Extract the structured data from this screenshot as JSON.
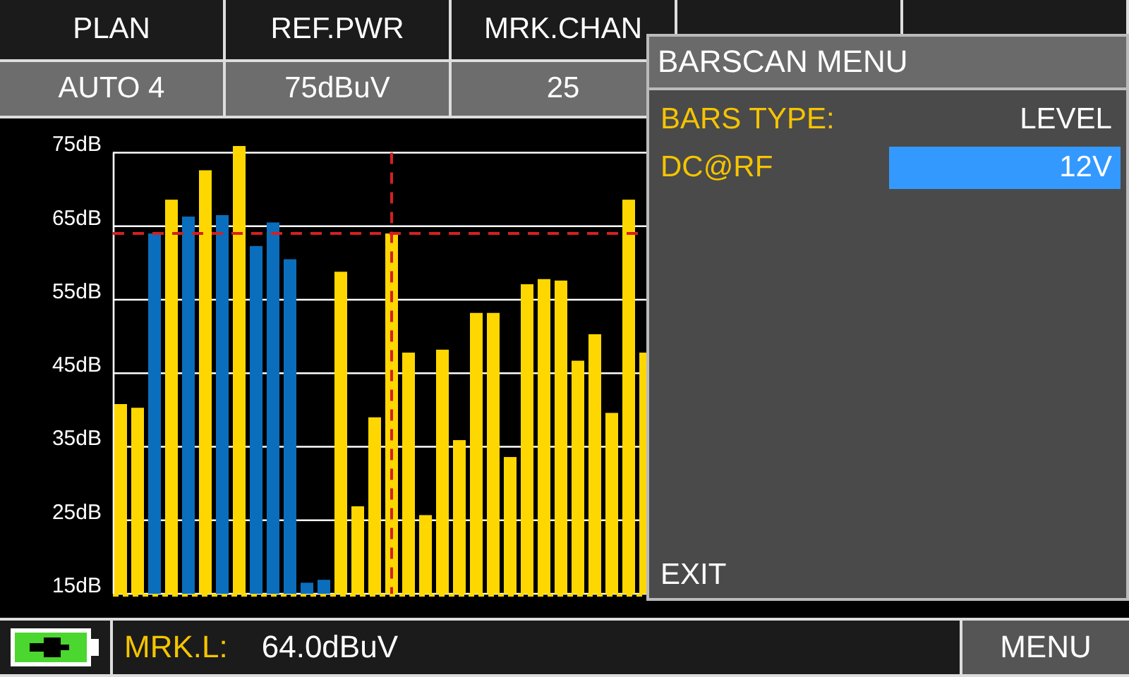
{
  "header": {
    "columns": [
      {
        "title": "PLAN",
        "value": "AUTO 4"
      },
      {
        "title": "REF.PWR",
        "value": "75dBuV"
      },
      {
        "title": "MRK.CHAN",
        "value": "25"
      },
      {},
      {}
    ]
  },
  "chart": {
    "chart_data": {
      "type": "bar",
      "ylim": [
        15,
        76
      ],
      "grid": true,
      "stacked": true,
      "yticks": [
        {
          "value": 75,
          "label": "75dB"
        },
        {
          "value": 65,
          "label": "65dB"
        },
        {
          "value": 55,
          "label": "55dB"
        },
        {
          "value": 45,
          "label": "45dB"
        },
        {
          "value": 35,
          "label": "35dB"
        },
        {
          "value": 25,
          "label": "25dB"
        },
        {
          "value": 15,
          "label": "15dB"
        }
      ],
      "series": [
        {
          "color": "#ffd700",
          "values": [
            40.8,
            40.3,
            null,
            68.6,
            null,
            72.6,
            null,
            75.9,
            null,
            null,
            null,
            null,
            null,
            58.8,
            26.9,
            39.0,
            64.0,
            47.8,
            25.7,
            48.2,
            35.9,
            53.2,
            53.2,
            33.6,
            57.1,
            57.8,
            57.6,
            46.7,
            50.3,
            39.6,
            68.6,
            47.8
          ]
        },
        {
          "color": "#0a6ebd",
          "values": [
            null,
            null,
            64.0,
            null,
            66.3,
            null,
            66.5,
            null,
            62.3,
            65.5,
            60.5,
            16.5,
            16.9,
            null,
            null,
            null,
            null,
            null,
            null,
            null,
            null,
            null,
            null,
            null,
            null,
            null,
            null,
            null,
            null,
            null,
            null,
            null
          ]
        }
      ],
      "ref_lines": [
        {
          "axis": "y",
          "value": 64
        }
      ]
    }
  },
  "menu": {
    "title": "BARSCAN MENU",
    "items": [
      {
        "label": "BARS TYPE:",
        "value": "LEVEL",
        "selected": false
      },
      {
        "label": "DC@RF",
        "value": "12V",
        "selected": true
      }
    ],
    "exit": "EXIT"
  },
  "status_bar": {
    "marker_label": "MRK.L:",
    "marker_value": "64.0dBuV",
    "menu_button": "MENU"
  }
}
